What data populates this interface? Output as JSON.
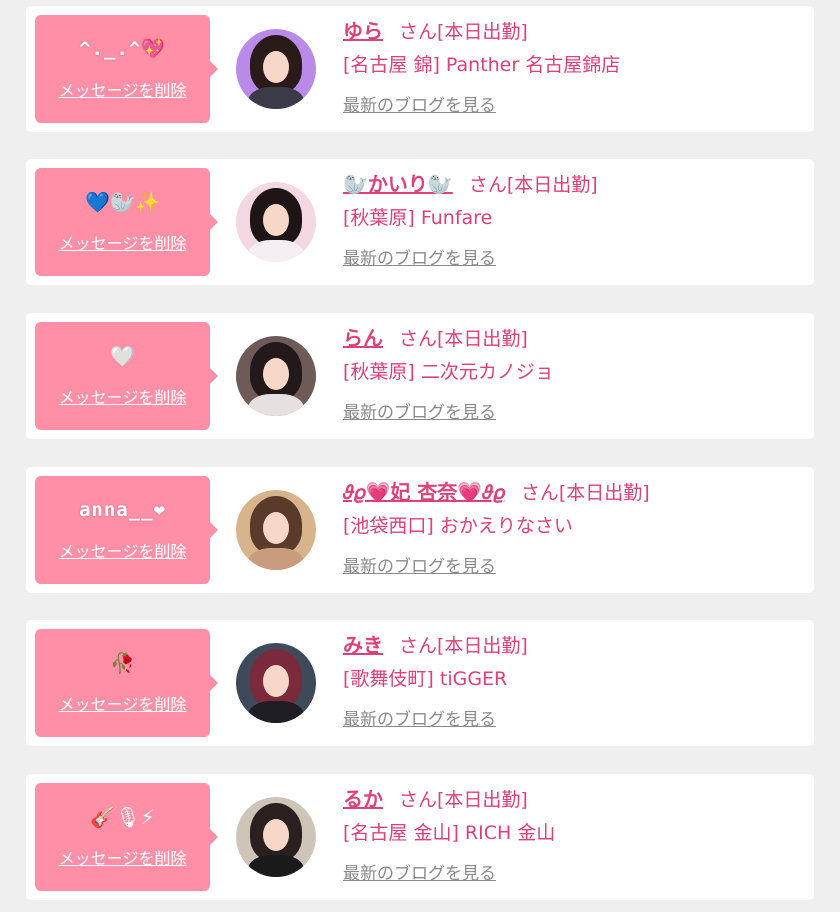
{
  "delete_label": "メッセージを削除",
  "blog_label": "最新のブログを見る",
  "san_label": "さん",
  "accent_color": "#ff8fa6",
  "name_color": "#e0407a",
  "cards": [
    {
      "message": "^._.^💖",
      "name": "ゆら",
      "status": "[本日出勤]",
      "shop": "[名古屋 錦] Panther 名古屋錦店"
    },
    {
      "message": "💙🦭✨",
      "name": "🦭かいり🦭",
      "status": "[本日出勤]",
      "shop": "[秋葉原] Funfare"
    },
    {
      "message": "🤍",
      "name": "らん",
      "status": "[本日出勤]",
      "shop": "[秋葉原] 二次元カノジョ"
    },
    {
      "message": "anna__❤",
      "name": "𝜗𝜚💗妃 杏奈💗𝜗𝜚",
      "status": "[本日出勤]",
      "shop": "[池袋西口] おかえりなさい"
    },
    {
      "message": "🥀",
      "name": "みき",
      "status": "[本日出勤]",
      "shop": "[歌舞伎町] tiGGER"
    },
    {
      "message": "🎸🎙⚡",
      "name": "るか",
      "status": "[本日出勤]",
      "shop": "[名古屋 金山] RICH 金山"
    }
  ]
}
